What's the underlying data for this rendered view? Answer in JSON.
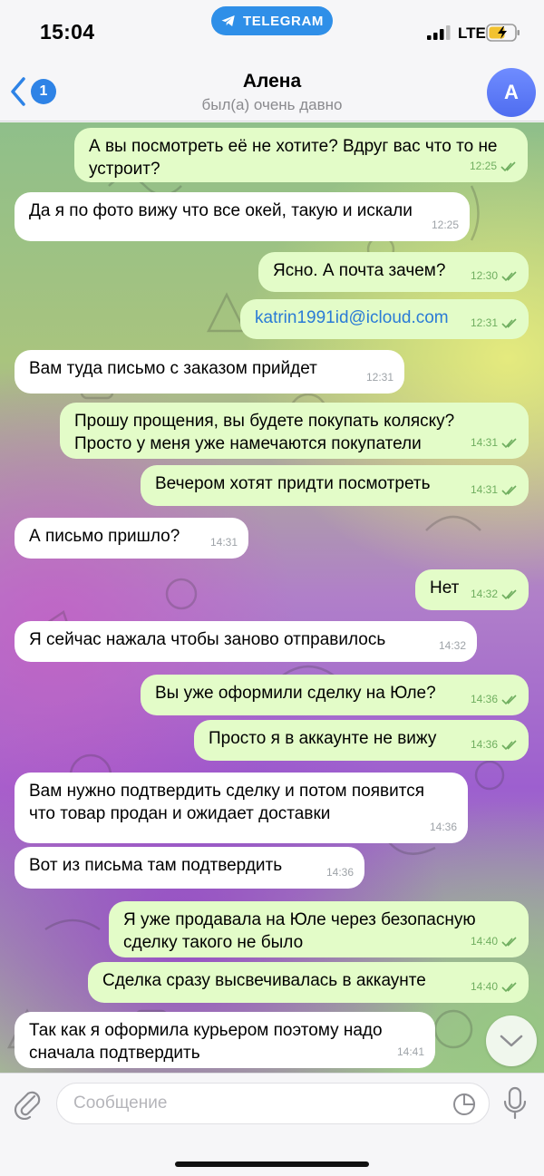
{
  "status_bar": {
    "time": "15:04",
    "app_pill": "TELEGRAM",
    "network": "LTE"
  },
  "header": {
    "back_badge": "1",
    "title": "Алена",
    "subtitle": "был(а) очень давно",
    "avatar_letter": "А"
  },
  "messages": [
    {
      "dir": "out",
      "text": "А вы посмотреть её не хотите? Вдруг вас что то не устроит?",
      "time": "12:25",
      "read": true
    },
    {
      "dir": "in",
      "text": "Да я по фото вижу что все окей, такую и искали",
      "time": "12:25"
    },
    {
      "dir": "out",
      "text": "Ясно. А почта зачем?",
      "time": "12:30",
      "read": true
    },
    {
      "dir": "out",
      "text": "katrin1991id@icloud.com",
      "time": "12:31",
      "read": true,
      "link": true
    },
    {
      "dir": "in",
      "text": "Вам туда письмо с заказом прийдет",
      "time": "12:31"
    },
    {
      "dir": "out",
      "text": "Прошу прощения, вы будете покупать коляску? Просто у меня уже намечаются покупатели",
      "time": "14:31",
      "read": true
    },
    {
      "dir": "out",
      "text": "Вечером хотят придти посмотреть",
      "time": "14:31",
      "read": true
    },
    {
      "dir": "in",
      "text": "А письмо пришло?",
      "time": "14:31"
    },
    {
      "dir": "out",
      "text": "Нет",
      "time": "14:32",
      "read": true
    },
    {
      "dir": "in",
      "text": "Я сейчас нажала чтобы заново отправилось",
      "time": "14:32"
    },
    {
      "dir": "out",
      "text": "Вы уже оформили сделку на Юле?",
      "time": "14:36",
      "read": true
    },
    {
      "dir": "out",
      "text": "Просто я в аккаунте не вижу",
      "time": "14:36",
      "read": true
    },
    {
      "dir": "in",
      "text": "Вам нужно подтвердить сделку и потом появится что товар продан и ожидает доставки",
      "time": "14:36"
    },
    {
      "dir": "in",
      "text": "Вот из письма там подтвердить",
      "time": "14:36"
    },
    {
      "dir": "out",
      "text": "Я уже продавала на Юле через безопасную сделку такого не было",
      "time": "14:40",
      "read": true
    },
    {
      "dir": "out",
      "text": "Сделка сразу высвечивалась в аккаунте",
      "time": "14:40",
      "read": true
    },
    {
      "dir": "in",
      "text": "Так как я оформила курьером поэтому надо сначала подтвердить",
      "time": "14:41"
    }
  ],
  "input": {
    "placeholder": "Сообщение"
  },
  "colors": {
    "incoming_bubble": "#ffffff",
    "outgoing_bubble": "#e3fcc8",
    "accent": "#2e83e6"
  },
  "icons": {
    "back": "chevron-left-icon",
    "attach": "paperclip-icon",
    "sticker": "sticker-icon",
    "mic": "microphone-icon",
    "scroll": "chevron-down-icon"
  }
}
